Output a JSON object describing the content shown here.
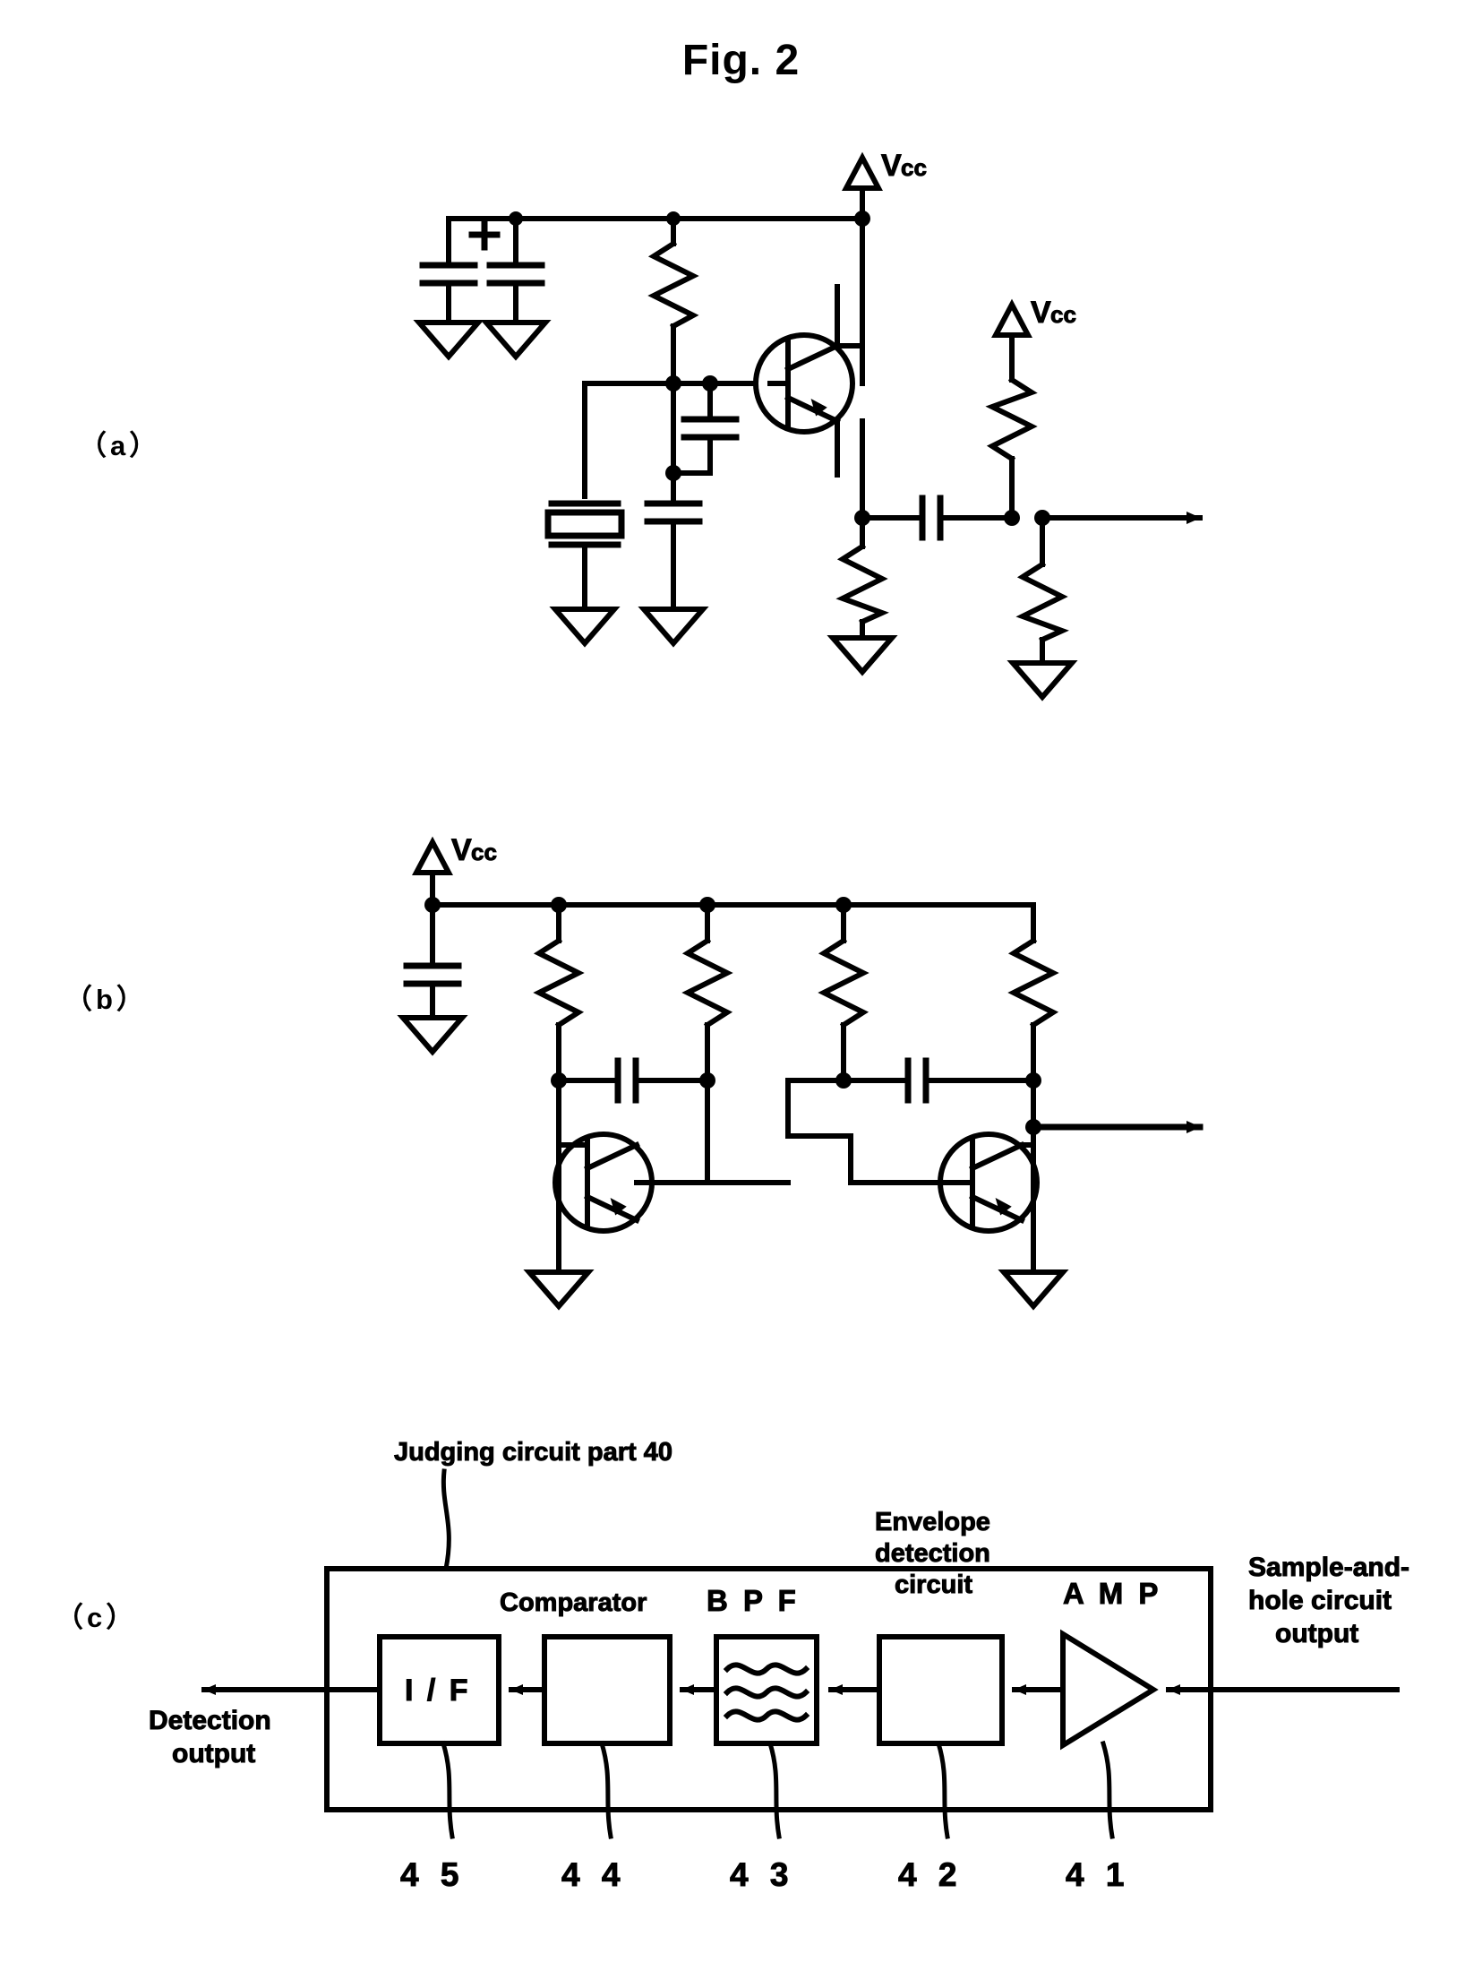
{
  "figure": {
    "title": "Fig. 2",
    "panels": [
      {
        "id": "a",
        "label": "（a）"
      },
      {
        "id": "b",
        "label": "（b）"
      },
      {
        "id": "c",
        "label": "（c）"
      }
    ]
  },
  "panel_a": {
    "name": "oscillator-circuit",
    "supply_labels": [
      {
        "v": "V",
        "cc": "cc"
      },
      {
        "v": "V",
        "cc": "cc"
      }
    ],
    "polarity_marks": [
      "+"
    ],
    "components": {
      "capacitors": 5,
      "resistors": 4,
      "transistors": 1,
      "crystal_resonators": 1,
      "grounds": 6
    }
  },
  "panel_b": {
    "name": "amplifier-circuit",
    "supply_labels": [
      {
        "v": "V",
        "cc": "cc"
      }
    ],
    "components": {
      "capacitors": 3,
      "resistors": 4,
      "transistors": 2,
      "grounds": 3
    }
  },
  "panel_c": {
    "name": "judging-circuit-block-diagram",
    "enclosure_label": "Judging circuit part 40",
    "input_label": "Sample-and-hole circuit output",
    "output_label": "Detection output",
    "blocks": [
      {
        "id": "if",
        "box_text": "I / F",
        "caption": "",
        "ref": "4 5"
      },
      {
        "id": "comp",
        "box_text": "",
        "caption": "Comparator",
        "ref": "4 4"
      },
      {
        "id": "bpf",
        "box_text": "",
        "caption": "B P F",
        "ref": "4 3"
      },
      {
        "id": "envelope",
        "box_text": "",
        "caption": "Envelope\ndetection\ncircuit",
        "ref": "4 2"
      },
      {
        "id": "amp",
        "box_text": "",
        "caption": "A M P",
        "ref": "4 1"
      }
    ],
    "captions": {
      "comparator": "Comparator",
      "bpf": "B P F",
      "envelope_line1": "Envelope",
      "envelope_line2": "detection",
      "envelope_line3": "circuit",
      "amp": "A M P",
      "input_line1": "Sample-and-",
      "input_line2": "hole circuit",
      "input_line3": "output",
      "output_line1": "Detection",
      "output_line2": "output",
      "if_box": "I / F"
    },
    "reference_numbers": [
      "4 5",
      "4 4",
      "4 3",
      "4 2",
      "4 1"
    ]
  },
  "colors": {
    "ink": "#000000",
    "paper": "#ffffff"
  }
}
